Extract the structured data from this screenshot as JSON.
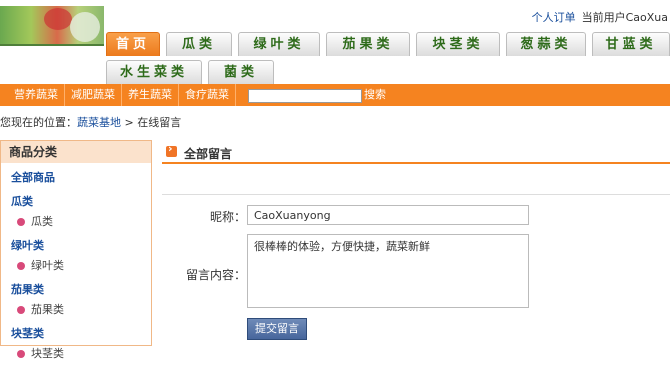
{
  "user": {
    "orders_link": "个人订单",
    "current_user": "当前用户CaoXua"
  },
  "tabs_row1": [
    "首页",
    "瓜类",
    "绿叶类",
    "茄果类",
    "块茎类",
    "葱蒜类",
    "甘蓝类"
  ],
  "tabs_row2": [
    "水生菜类",
    "菌类"
  ],
  "nav": {
    "items": [
      "营养蔬菜",
      "减肥蔬菜",
      "养生蔬菜",
      "食疗蔬菜"
    ],
    "search_value": "",
    "search_label": "搜索"
  },
  "breadcrumb": {
    "prefix": "您现在的位置：",
    "home": "蔬菜基地",
    "sep": ">",
    "current": "在线留言"
  },
  "sidebar": {
    "title": "商品分类",
    "all": "全部商品",
    "categories": [
      {
        "name": "瓜类",
        "sub": "瓜类"
      },
      {
        "name": "绿叶类",
        "sub": "绿叶类"
      },
      {
        "name": "茄果类",
        "sub": "茄果类"
      },
      {
        "name": "块茎类",
        "sub": "块茎类"
      }
    ]
  },
  "main": {
    "title": "全部留言",
    "nickname_label": "昵称：",
    "nickname_value": "CaoXuanyong",
    "message_label": "留言内容：",
    "message_value": "很棒棒的体验，方便快捷，蔬菜新鲜",
    "submit_label": "提交留言"
  }
}
